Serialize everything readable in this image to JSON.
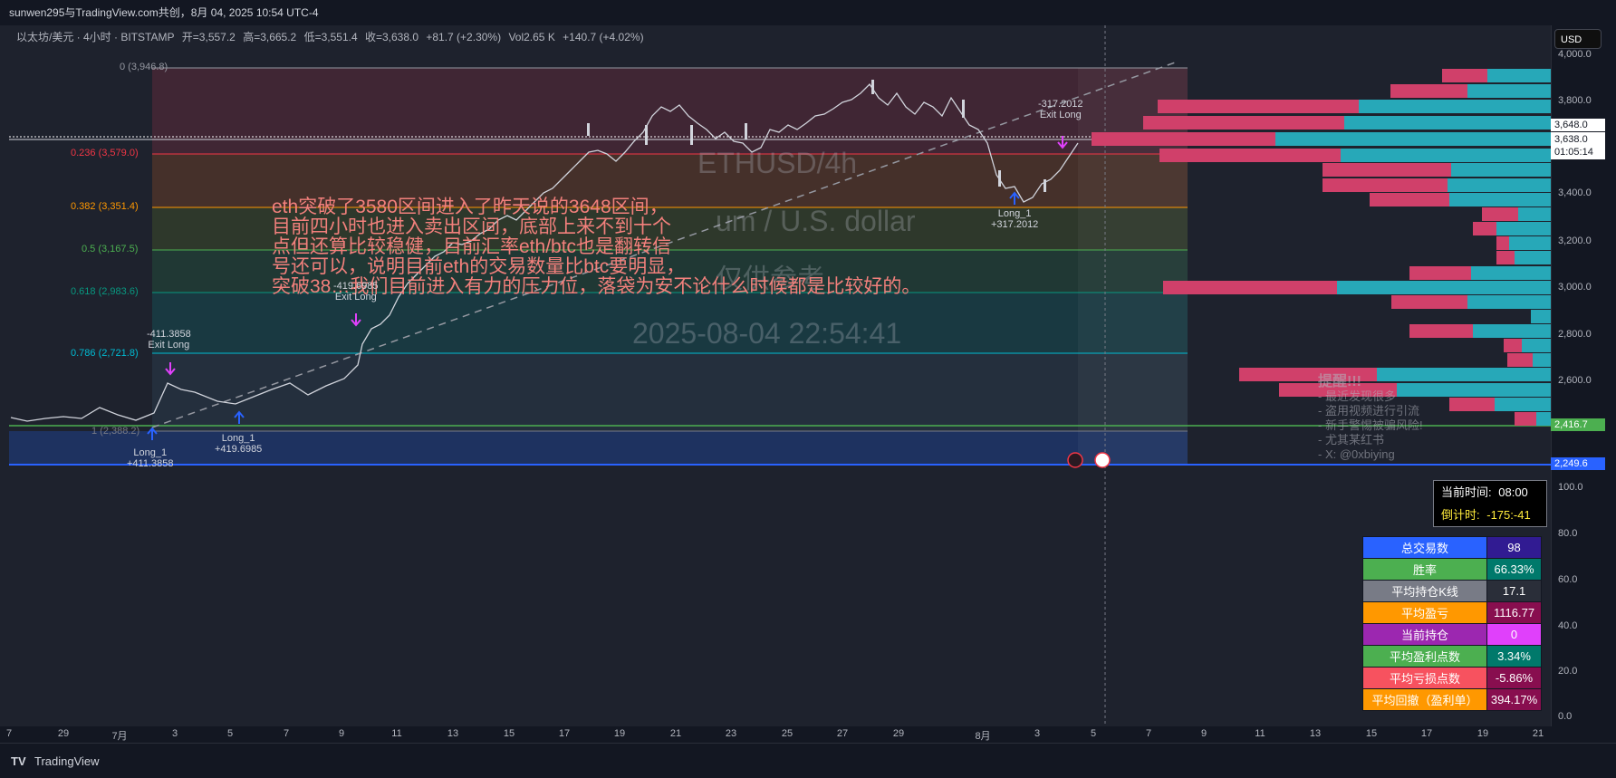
{
  "header": {
    "title": "sunwen295与TradingView.com共创，8月 04, 2025 10:54 UTC-4"
  },
  "legend": {
    "symbol": "以太坊/美元 · 4小时 · BITSTAMP",
    "open": "开=3,557.2",
    "high": "高=3,665.2",
    "low": "低=3,551.4",
    "close": "收=3,638.0",
    "change": "+81.7 (+2.30%)",
    "vol_label": "Vol",
    "vol": "2.65 K",
    "vol_change": "+140.7 (+4.02%)"
  },
  "currency_button": "USD",
  "fib_levels": [
    {
      "label": "0 (3,946.8)",
      "color": "#9598a1"
    },
    {
      "label": "0.236 (3,579.0)",
      "color": "#f23645"
    },
    {
      "label": "0.382 (3,351.4)",
      "color": "#ff9800"
    },
    {
      "label": "0.5 (3,167.5)",
      "color": "#4caf50"
    },
    {
      "label": "0.618 (2,983.6)",
      "color": "#089981"
    },
    {
      "label": "0.786 (2,721.8)",
      "color": "#00bcd4"
    },
    {
      "label": "1 (2,388.2)",
      "color": "#787b86"
    }
  ],
  "price_axis": {
    "labels": [
      "4,000.0",
      "3,800.0",
      "3,400.0",
      "3,200.0",
      "3,000.0",
      "2,800.0",
      "2,600.0",
      "100.0",
      "80.0",
      "60.0",
      "40.0",
      "20.0",
      "0.0"
    ],
    "tags": {
      "current_price": "3,648.0",
      "close_price": "3,638.0",
      "countdown": "01:05:14",
      "green_level": "2,416.7",
      "blue_level": "2,249.6"
    }
  },
  "time_axis": [
    "7",
    "29",
    "7月",
    "3",
    "5",
    "7",
    "9",
    "11",
    "13",
    "15",
    "17",
    "19",
    "21",
    "23",
    "25",
    "27",
    "29",
    "8月",
    "3",
    "5",
    "7",
    "9",
    "11",
    "13",
    "15",
    "17",
    "19",
    "21"
  ],
  "annotation": {
    "lines": [
      "eth突破了3580区间进入了昨天说的3648区间，",
      "目前四小时也进入卖出区间，底部上来不到十个",
      "点但还算比较稳健，目前汇率eth/btc也是翻转信",
      "号还可以，说明目前eth的交易数量比btc要明显，",
      "突破38…我们目前进入有力的压力位，落袋为安不论什么时候都是比较好的。"
    ]
  },
  "watermark": {
    "symbol": "ETHUSD/4h",
    "name": "um / U.S. dollar",
    "note": "仅供参考",
    "datetime": "2025-08-04 22:54:41"
  },
  "trades": [
    {
      "name": "Long_1",
      "pnl": "+411.3858"
    },
    {
      "name": "Exit Long",
      "pnl": "-411.3858"
    },
    {
      "name": "Long_1",
      "pnl": "+419.6985"
    },
    {
      "name": "Exit Long",
      "pnl": "-419.6985"
    },
    {
      "name": "Long_1",
      "pnl": "+317.2012"
    },
    {
      "name": "Exit Long",
      "pnl": "-317.2012"
    }
  ],
  "reminder": {
    "title": "提醒!!!",
    "items": [
      "- 最近发现很多",
      "- 盗用视频进行引流",
      "- 新手警惕被骗风险!",
      "- 尤其某红书",
      "- X: @0xbiying"
    ]
  },
  "timer": {
    "current_label": "当前时间:",
    "current_value": "08:00",
    "countdown_label": "倒计时:",
    "countdown_value": "-175:-41"
  },
  "stats": [
    {
      "label": "总交易数",
      "value": "98",
      "label_color": "#2962ff",
      "value_color": "#311b92"
    },
    {
      "label": "胜率",
      "value": "66.33%",
      "label_color": "#4caf50",
      "value_color": "#00796b"
    },
    {
      "label": "平均持仓K线",
      "value": "17.1",
      "label_color": "#787b86",
      "value_color": "#2a2e39"
    },
    {
      "label": "平均盈亏",
      "value": "1116.77",
      "label_color": "#ff9800",
      "value_color": "#880e4f"
    },
    {
      "label": "当前持仓",
      "value": "0",
      "label_color": "#9c27b0",
      "value_color": "#e040fb"
    },
    {
      "label": "平均盈利点数",
      "value": "3.34%",
      "label_color": "#4caf50",
      "value_color": "#00796b"
    },
    {
      "label": "平均亏损点数",
      "value": "-5.86%",
      "label_color": "#f7525f",
      "value_color": "#880e4f"
    },
    {
      "label": "平均回撤（盈利单）",
      "value": "394.17%",
      "label_color": "#ff9800",
      "value_color": "#880e4f"
    }
  ],
  "footer": {
    "brand": "TradingView"
  }
}
